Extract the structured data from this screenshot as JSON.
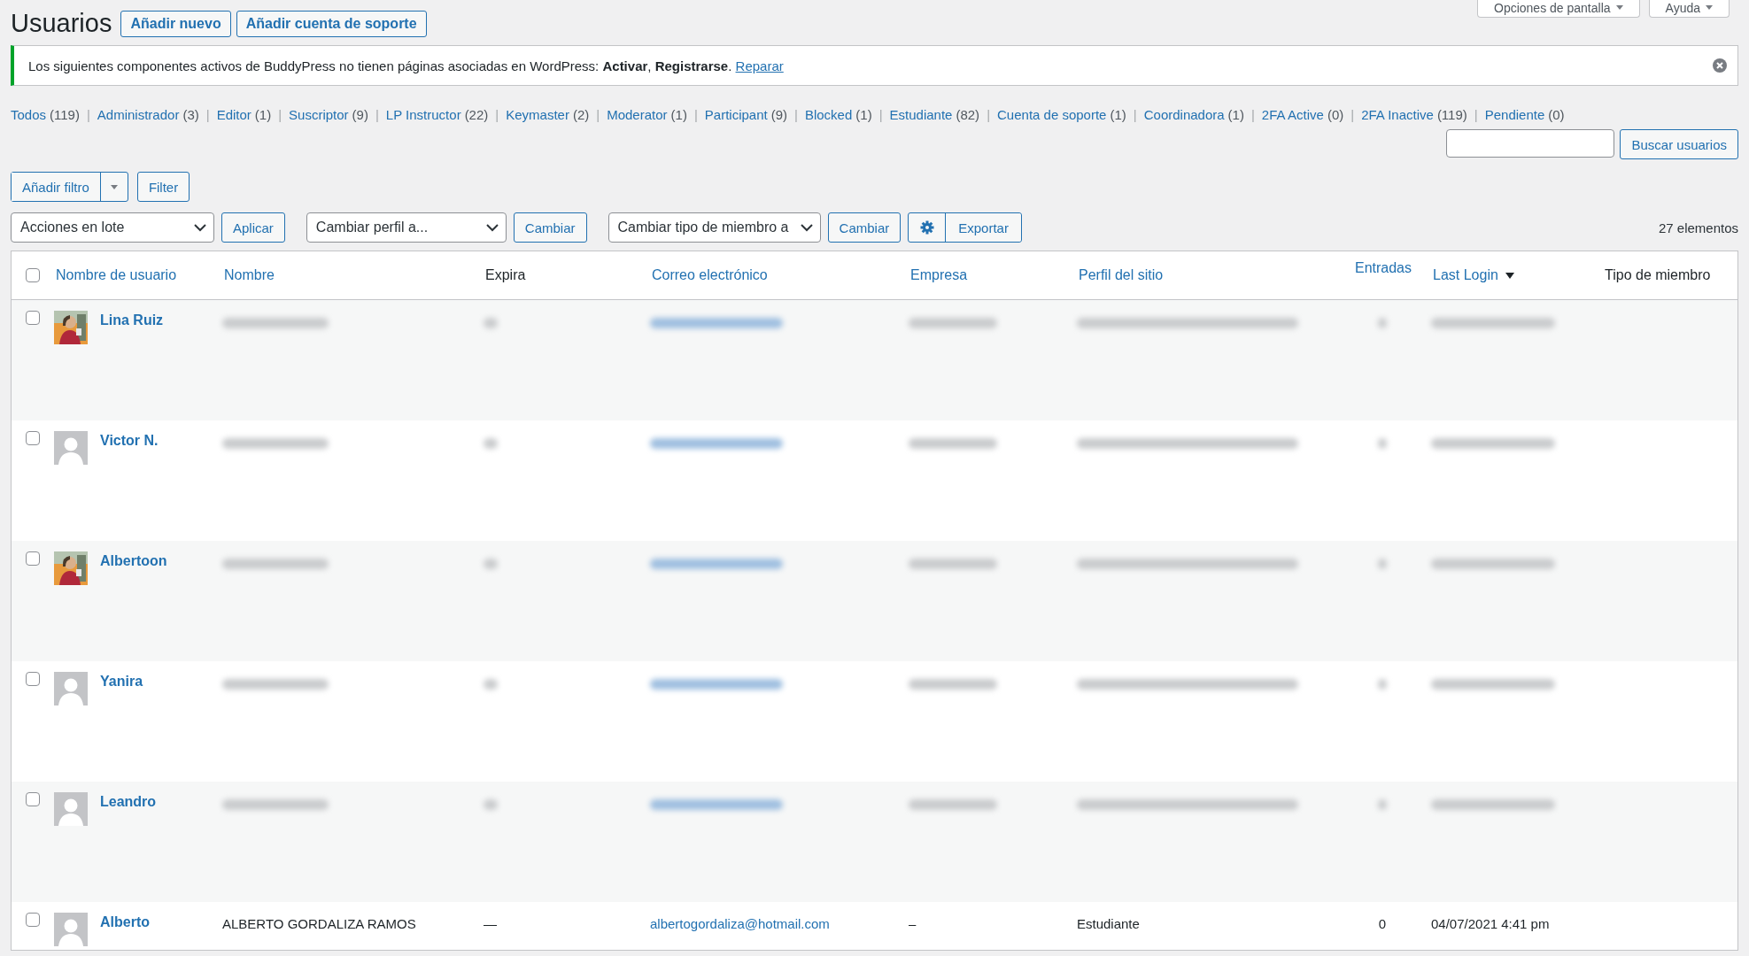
{
  "page_title": "Usuarios",
  "title_actions": [
    "Añadir nuevo",
    "Añadir cuenta de soporte"
  ],
  "screen_tabs": [
    "Opciones de pantalla",
    "Ayuda"
  ],
  "notice": {
    "text": "Los siguientes componentes activos de BuddyPress no tienen páginas asociadas en WordPress: **Activar**, **Registrarse**.",
    "link": "Reparar"
  },
  "role_separator": "|",
  "role_filters": [
    {
      "label": "Todos",
      "count": "(119)"
    },
    {
      "label": "Administrador",
      "count": "(3)"
    },
    {
      "label": "Editor",
      "count": "(1)"
    },
    {
      "label": "Suscriptor",
      "count": "(9)"
    },
    {
      "label": "LP Instructor",
      "count": "(22)"
    },
    {
      "label": "Keymaster",
      "count": "(2)"
    },
    {
      "label": "Moderator",
      "count": "(1)"
    },
    {
      "label": "Participant",
      "count": "(9)"
    },
    {
      "label": "Blocked",
      "count": "(1)"
    },
    {
      "label": "Estudiante",
      "count": "(82)"
    },
    {
      "label": "Cuenta de soporte",
      "count": "(1)"
    },
    {
      "label": "Coordinadora",
      "count": "(1)"
    },
    {
      "label": "2FA Active",
      "count": "(0)"
    },
    {
      "label": "2FA Inactive",
      "count": "(119)"
    },
    {
      "label": "Pendiente",
      "count": "(0)"
    }
  ],
  "search": {
    "button": "Buscar usuarios"
  },
  "filter_bar": {
    "add_filter": "Añadir filtro",
    "filter": "Filter"
  },
  "bulk_bar": {
    "bulk_select": "Acciones en lote",
    "apply": "Aplicar",
    "profile_select": "Cambiar perfil a...",
    "profile_apply": "Cambiar",
    "member_select": "Cambiar tipo de miembro a",
    "member_apply": "Cambiar",
    "export": "Exportar",
    "count": "27 elementos"
  },
  "table": {
    "select_all_checked": false,
    "columns": [
      {
        "label": "Nombre de usuario",
        "kind": "sortable",
        "sorted": false
      },
      {
        "label": "Nombre",
        "kind": "sortable",
        "sorted": false
      },
      {
        "label": "Expira",
        "kind": "plain",
        "sorted": false
      },
      {
        "label": "Correo electrónico",
        "kind": "sortable",
        "sorted": false
      },
      {
        "label": "Empresa",
        "kind": "sortable",
        "sorted": false
      },
      {
        "label": "Perfil del sitio",
        "kind": "sortable",
        "sorted": false
      },
      {
        "label": "Entradas",
        "kind": "sortable",
        "sorted": false
      },
      {
        "label": "Last Login",
        "kind": "sortable",
        "sorted": true
      },
      {
        "label": "Tipo de miembro",
        "kind": "plain",
        "sorted": false
      }
    ],
    "rows": [
      {
        "checked": false,
        "cells": [
          {
            "kind": "user",
            "text": "Lina Ruiz"
          },
          {
            "kind": "redacted"
          },
          {
            "kind": "redacted"
          },
          {
            "kind": "redacted"
          },
          {
            "kind": "redacted"
          },
          {
            "kind": "redacted"
          },
          {
            "kind": "redacted"
          },
          {
            "kind": "redacted"
          }
        ]
      },
      {
        "checked": false,
        "cells": [
          {
            "kind": "user",
            "text": "Victor N.",
            "avatar": {
              "kind": "default"
            }
          },
          {
            "kind": "redacted"
          },
          {
            "kind": "redacted"
          },
          {
            "kind": "redacted"
          },
          {
            "kind": "redacted"
          },
          {
            "kind": "redacted"
          },
          {
            "kind": "redacted"
          },
          {
            "kind": "redacted"
          }
        ]
      },
      {
        "checked": false,
        "cells": [
          {
            "kind": "user",
            "text": "Albertoon"
          },
          {
            "kind": "redacted"
          },
          {
            "kind": "redacted"
          },
          {
            "kind": "redacted"
          },
          {
            "kind": "redacted"
          },
          {
            "kind": "redacted"
          },
          {
            "kind": "redacted"
          },
          {
            "kind": "redacted"
          }
        ]
      },
      {
        "checked": false,
        "cells": [
          {
            "kind": "user",
            "text": "Yanira",
            "avatar": {
              "kind": "default"
            }
          },
          {
            "kind": "redacted"
          },
          {
            "kind": "redacted"
          },
          {
            "kind": "redacted"
          },
          {
            "kind": "redacted"
          },
          {
            "kind": "redacted"
          },
          {
            "kind": "redacted"
          },
          {
            "kind": "redacted"
          }
        ]
      },
      {
        "checked": false,
        "cells": [
          {
            "kind": "user",
            "text": "Leandro",
            "avatar": {
              "kind": "default"
            }
          },
          {
            "kind": "redacted"
          },
          {
            "kind": "redacted"
          },
          {
            "kind": "redacted"
          },
          {
            "kind": "redacted"
          },
          {
            "kind": "redacted"
          },
          {
            "kind": "redacted"
          },
          {
            "kind": "redacted"
          }
        ]
      },
      {
        "checked": false,
        "cells": [
          {
            "kind": "user",
            "text": "Alberto",
            "avatar": {
              "kind": "default"
            }
          },
          {
            "kind": "text",
            "text": "ALBERTO GORDALIZA RAMOS"
          },
          {
            "kind": "text",
            "text": "—"
          },
          {
            "kind": "text",
            "text": "albertogordaliza@hotmail.com"
          },
          {
            "kind": "text",
            "text": "–"
          },
          {
            "kind": "text",
            "text": "Estudiante"
          },
          {
            "kind": "text",
            "text": "0"
          },
          {
            "kind": "text",
            "text": "04/07/2021 4:41 pm"
          }
        ]
      }
    ]
  }
}
